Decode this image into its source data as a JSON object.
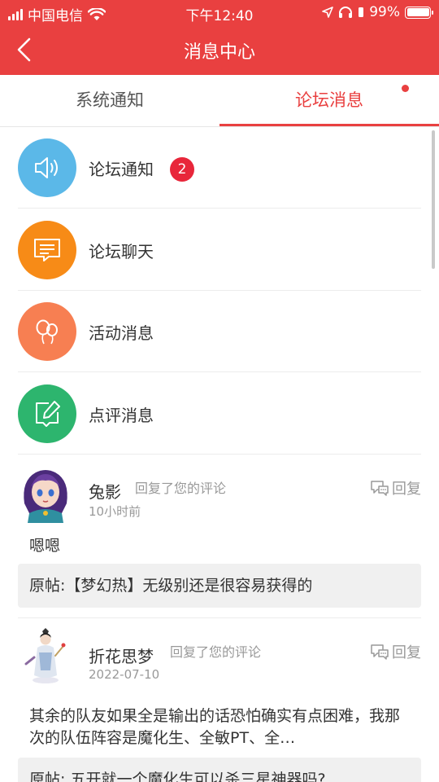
{
  "status_bar": {
    "carrier": "中国电信",
    "time": "下午12:40",
    "battery": "99%"
  },
  "nav": {
    "title": "消息中心"
  },
  "tabs": [
    {
      "label": "系统通知",
      "active": false
    },
    {
      "label": "论坛消息",
      "active": true,
      "has_dot": true
    }
  ],
  "categories": [
    {
      "label": "论坛通知",
      "icon": "speaker-icon",
      "color": "#5bb8e8",
      "badge": "2"
    },
    {
      "label": "论坛聊天",
      "icon": "chat-icon",
      "color": "#f78b17"
    },
    {
      "label": "活动消息",
      "icon": "balloon-icon",
      "color": "#f77f52"
    },
    {
      "label": "点评消息",
      "icon": "edit-icon",
      "color": "#2db56e"
    }
  ],
  "messages": [
    {
      "user": "兔影",
      "action": "回复了您的评论",
      "time": "10小时前",
      "reply_label": "回复",
      "content": "嗯嗯",
      "original": "原帖:【梦幻热】无级别还是很容易获得的"
    },
    {
      "user": "折花思梦",
      "action": "回复了您的评论",
      "time": "2022-07-10",
      "reply_label": "回复",
      "content": "其余的队友如果全是输出的话恐怕确实有点困难，我那次的队伍阵容是魔化生、全敏PT、全…",
      "original": "原帖: 五开就一个魔化生可以杀三星神器吗?"
    }
  ]
}
